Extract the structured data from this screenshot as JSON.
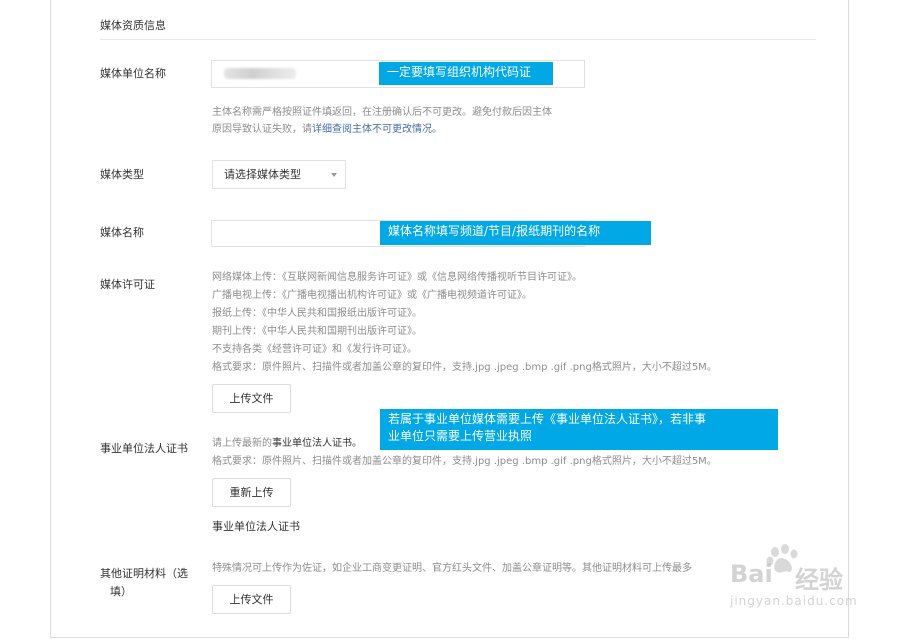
{
  "section": {
    "title": "媒体资质信息"
  },
  "fields": {
    "org_name": {
      "label": "媒体单位名称",
      "callout": "一定要填写组织机构代码证",
      "tip_line1": "主体名称需严格按照证件填返回，在注册确认后不可更改。避免付款后因主体",
      "tip_line2_prefix": "原因导致认证失败，请",
      "tip_line2_link": "详细查阅主体不可更改情况。"
    },
    "media_type": {
      "label": "媒体类型",
      "select_value": "请选择媒体类型"
    },
    "media_name": {
      "label": "媒体名称",
      "callout": "媒体名称填写频道/节目/报纸期刊的名称"
    },
    "license": {
      "label": "媒体许可证",
      "lines": [
        "网络媒体上传：《互联网新闻信息服务许可证》或《信息网络传播视听节目许可证》。",
        "广播电视上传：《广播电视播出机构许可证》或《广播电视频道许可证》。",
        "报纸上传：《中华人民共和国报纸出版许可证》。",
        "期刊上传：《中华人民共和国期刊出版许可证》。",
        "不支持各类《经营许可证》和《发行许可证》。",
        "格式要求：原件照片、扫描件或者加盖公章的复印件，支持.jpg .jpeg .bmp .gif .png格式照片，大小不超过5M。"
      ],
      "upload_label": "上传文件"
    },
    "legal_cert": {
      "label": "事业单位法人证书",
      "callout_line1": "若属于事业单位媒体需要上传《事业单位法人证书》，若非事",
      "callout_line2": "业单位只需要上传营业执照",
      "tip_prefix": "请上传最新的",
      "tip_dark": "事业单位法人证书。",
      "format": "格式要求：原件照片、扫描件或者加盖公章的复印件，支持.jpg .jpeg .bmp .gif .png格式照片，大小不超过5M。",
      "reupload_label": "重新上传",
      "file_caption": "事业单位法人证书"
    },
    "other": {
      "label_line1": "其他证明材料（选",
      "label_line2": "填）",
      "tip": "特殊情况可上传作为佐证，如企业工商变更证明、官方红头文件、加盖公章证明等。其他证明材料可上传最多",
      "upload_label": "上传文件"
    }
  },
  "watermark": {
    "brand_left": "Bai",
    "brand_right": "经验",
    "url": "jingyan.baidu.com"
  },
  "colors": {
    "callout_bg": "#00a8e6",
    "link": "#466ea6",
    "tip_text": "#8d8d8d"
  }
}
